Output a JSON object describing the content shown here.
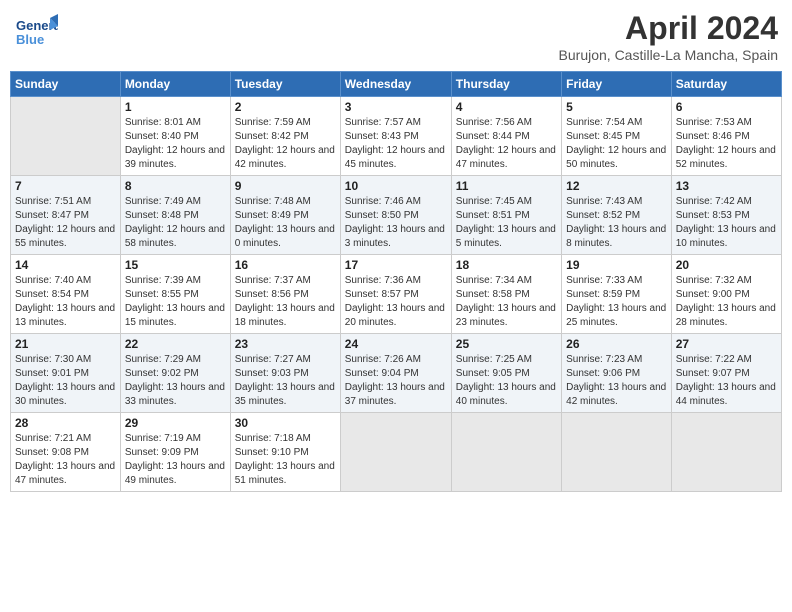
{
  "header": {
    "logo_line1": "General",
    "logo_line2": "Blue",
    "month_year": "April 2024",
    "location": "Burujon, Castille-La Mancha, Spain"
  },
  "days_of_week": [
    "Sunday",
    "Monday",
    "Tuesday",
    "Wednesday",
    "Thursday",
    "Friday",
    "Saturday"
  ],
  "weeks": [
    [
      {
        "day": "",
        "empty": true
      },
      {
        "day": "1",
        "rise": "8:01 AM",
        "set": "8:40 PM",
        "daylight": "12 hours and 39 minutes."
      },
      {
        "day": "2",
        "rise": "7:59 AM",
        "set": "8:42 PM",
        "daylight": "12 hours and 42 minutes."
      },
      {
        "day": "3",
        "rise": "7:57 AM",
        "set": "8:43 PM",
        "daylight": "12 hours and 45 minutes."
      },
      {
        "day": "4",
        "rise": "7:56 AM",
        "set": "8:44 PM",
        "daylight": "12 hours and 47 minutes."
      },
      {
        "day": "5",
        "rise": "7:54 AM",
        "set": "8:45 PM",
        "daylight": "12 hours and 50 minutes."
      },
      {
        "day": "6",
        "rise": "7:53 AM",
        "set": "8:46 PM",
        "daylight": "12 hours and 52 minutes."
      }
    ],
    [
      {
        "day": "7",
        "rise": "7:51 AM",
        "set": "8:47 PM",
        "daylight": "12 hours and 55 minutes."
      },
      {
        "day": "8",
        "rise": "7:49 AM",
        "set": "8:48 PM",
        "daylight": "12 hours and 58 minutes."
      },
      {
        "day": "9",
        "rise": "7:48 AM",
        "set": "8:49 PM",
        "daylight": "13 hours and 0 minutes."
      },
      {
        "day": "10",
        "rise": "7:46 AM",
        "set": "8:50 PM",
        "daylight": "13 hours and 3 minutes."
      },
      {
        "day": "11",
        "rise": "7:45 AM",
        "set": "8:51 PM",
        "daylight": "13 hours and 5 minutes."
      },
      {
        "day": "12",
        "rise": "7:43 AM",
        "set": "8:52 PM",
        "daylight": "13 hours and 8 minutes."
      },
      {
        "day": "13",
        "rise": "7:42 AM",
        "set": "8:53 PM",
        "daylight": "13 hours and 10 minutes."
      }
    ],
    [
      {
        "day": "14",
        "rise": "7:40 AM",
        "set": "8:54 PM",
        "daylight": "13 hours and 13 minutes."
      },
      {
        "day": "15",
        "rise": "7:39 AM",
        "set": "8:55 PM",
        "daylight": "13 hours and 15 minutes."
      },
      {
        "day": "16",
        "rise": "7:37 AM",
        "set": "8:56 PM",
        "daylight": "13 hours and 18 minutes."
      },
      {
        "day": "17",
        "rise": "7:36 AM",
        "set": "8:57 PM",
        "daylight": "13 hours and 20 minutes."
      },
      {
        "day": "18",
        "rise": "7:34 AM",
        "set": "8:58 PM",
        "daylight": "13 hours and 23 minutes."
      },
      {
        "day": "19",
        "rise": "7:33 AM",
        "set": "8:59 PM",
        "daylight": "13 hours and 25 minutes."
      },
      {
        "day": "20",
        "rise": "7:32 AM",
        "set": "9:00 PM",
        "daylight": "13 hours and 28 minutes."
      }
    ],
    [
      {
        "day": "21",
        "rise": "7:30 AM",
        "set": "9:01 PM",
        "daylight": "13 hours and 30 minutes."
      },
      {
        "day": "22",
        "rise": "7:29 AM",
        "set": "9:02 PM",
        "daylight": "13 hours and 33 minutes."
      },
      {
        "day": "23",
        "rise": "7:27 AM",
        "set": "9:03 PM",
        "daylight": "13 hours and 35 minutes."
      },
      {
        "day": "24",
        "rise": "7:26 AM",
        "set": "9:04 PM",
        "daylight": "13 hours and 37 minutes."
      },
      {
        "day": "25",
        "rise": "7:25 AM",
        "set": "9:05 PM",
        "daylight": "13 hours and 40 minutes."
      },
      {
        "day": "26",
        "rise": "7:23 AM",
        "set": "9:06 PM",
        "daylight": "13 hours and 42 minutes."
      },
      {
        "day": "27",
        "rise": "7:22 AM",
        "set": "9:07 PM",
        "daylight": "13 hours and 44 minutes."
      }
    ],
    [
      {
        "day": "28",
        "rise": "7:21 AM",
        "set": "9:08 PM",
        "daylight": "13 hours and 47 minutes."
      },
      {
        "day": "29",
        "rise": "7:19 AM",
        "set": "9:09 PM",
        "daylight": "13 hours and 49 minutes."
      },
      {
        "day": "30",
        "rise": "7:18 AM",
        "set": "9:10 PM",
        "daylight": "13 hours and 51 minutes."
      },
      {
        "day": "",
        "empty": true
      },
      {
        "day": "",
        "empty": true
      },
      {
        "day": "",
        "empty": true
      },
      {
        "day": "",
        "empty": true
      }
    ]
  ],
  "labels": {
    "sunrise": "Sunrise:",
    "sunset": "Sunset:",
    "daylight": "Daylight:"
  }
}
